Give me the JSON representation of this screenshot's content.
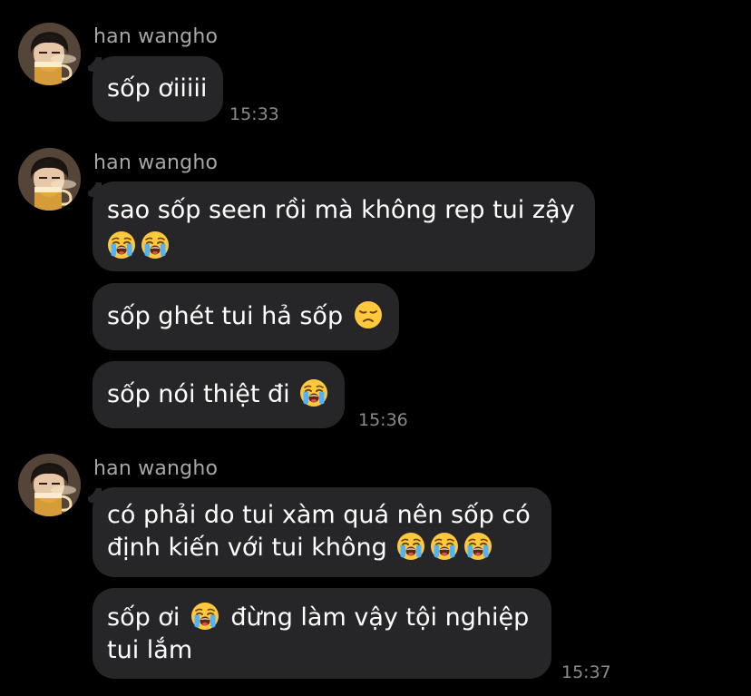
{
  "colors": {
    "background": "#000000",
    "bubble": "#262628",
    "sender_name": "#a7a7a7",
    "timestamp": "#8a8a8a",
    "emoji_face": "#ffc83d"
  },
  "groups": [
    {
      "sender": "han wangho",
      "messages": [
        {
          "text": "sốp ơiiiii",
          "emojis": []
        }
      ],
      "time": "15:33"
    },
    {
      "sender": "han wangho",
      "messages": [
        {
          "line1": "sao sốp seen rồi mà không rep tui zậy",
          "emojis": [
            "loudly-crying-face",
            "loudly-crying-face"
          ]
        },
        {
          "text": "sốp ghét tui hả sốp",
          "emojis": [
            "disappointed-face"
          ]
        },
        {
          "text": "sốp nói thiệt đi",
          "emojis": [
            "loudly-crying-face"
          ]
        }
      ],
      "time": "15:36"
    },
    {
      "sender": "han wangho",
      "messages": [
        {
          "line1": "có phải do tui xàm quá nên sốp có",
          "line2": "định kiến với tui không",
          "emojis": [
            "loudly-crying-face",
            "loudly-crying-face",
            "loudly-crying-face"
          ]
        },
        {
          "line1a": "sốp ơi",
          "line1b": "đừng làm vậy tội nghiệp",
          "line2": "tui lắm",
          "emojis": [
            "loudly-crying-face"
          ]
        }
      ],
      "time": "15:37"
    }
  ]
}
